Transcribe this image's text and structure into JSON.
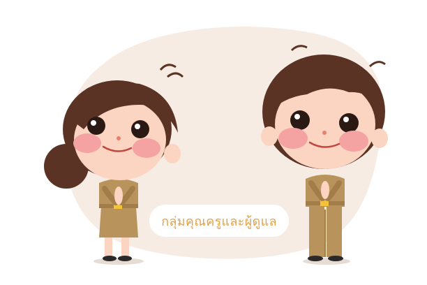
{
  "banner": {
    "label": "กลุ่มคุณครูและผู้ดูแล"
  },
  "colors": {
    "background_blob": "#f7ece4",
    "hair": "#5a3325",
    "skin": "#fbd4c2",
    "cheek": "#f4a2a2",
    "uniform": "#b8935c",
    "uniform_shadow": "#a27d49",
    "belt_buckle": "#f2c23a",
    "label_text": "#e2a24a"
  },
  "illustration": {
    "characters": [
      "female-teacher",
      "male-teacher"
    ]
  }
}
